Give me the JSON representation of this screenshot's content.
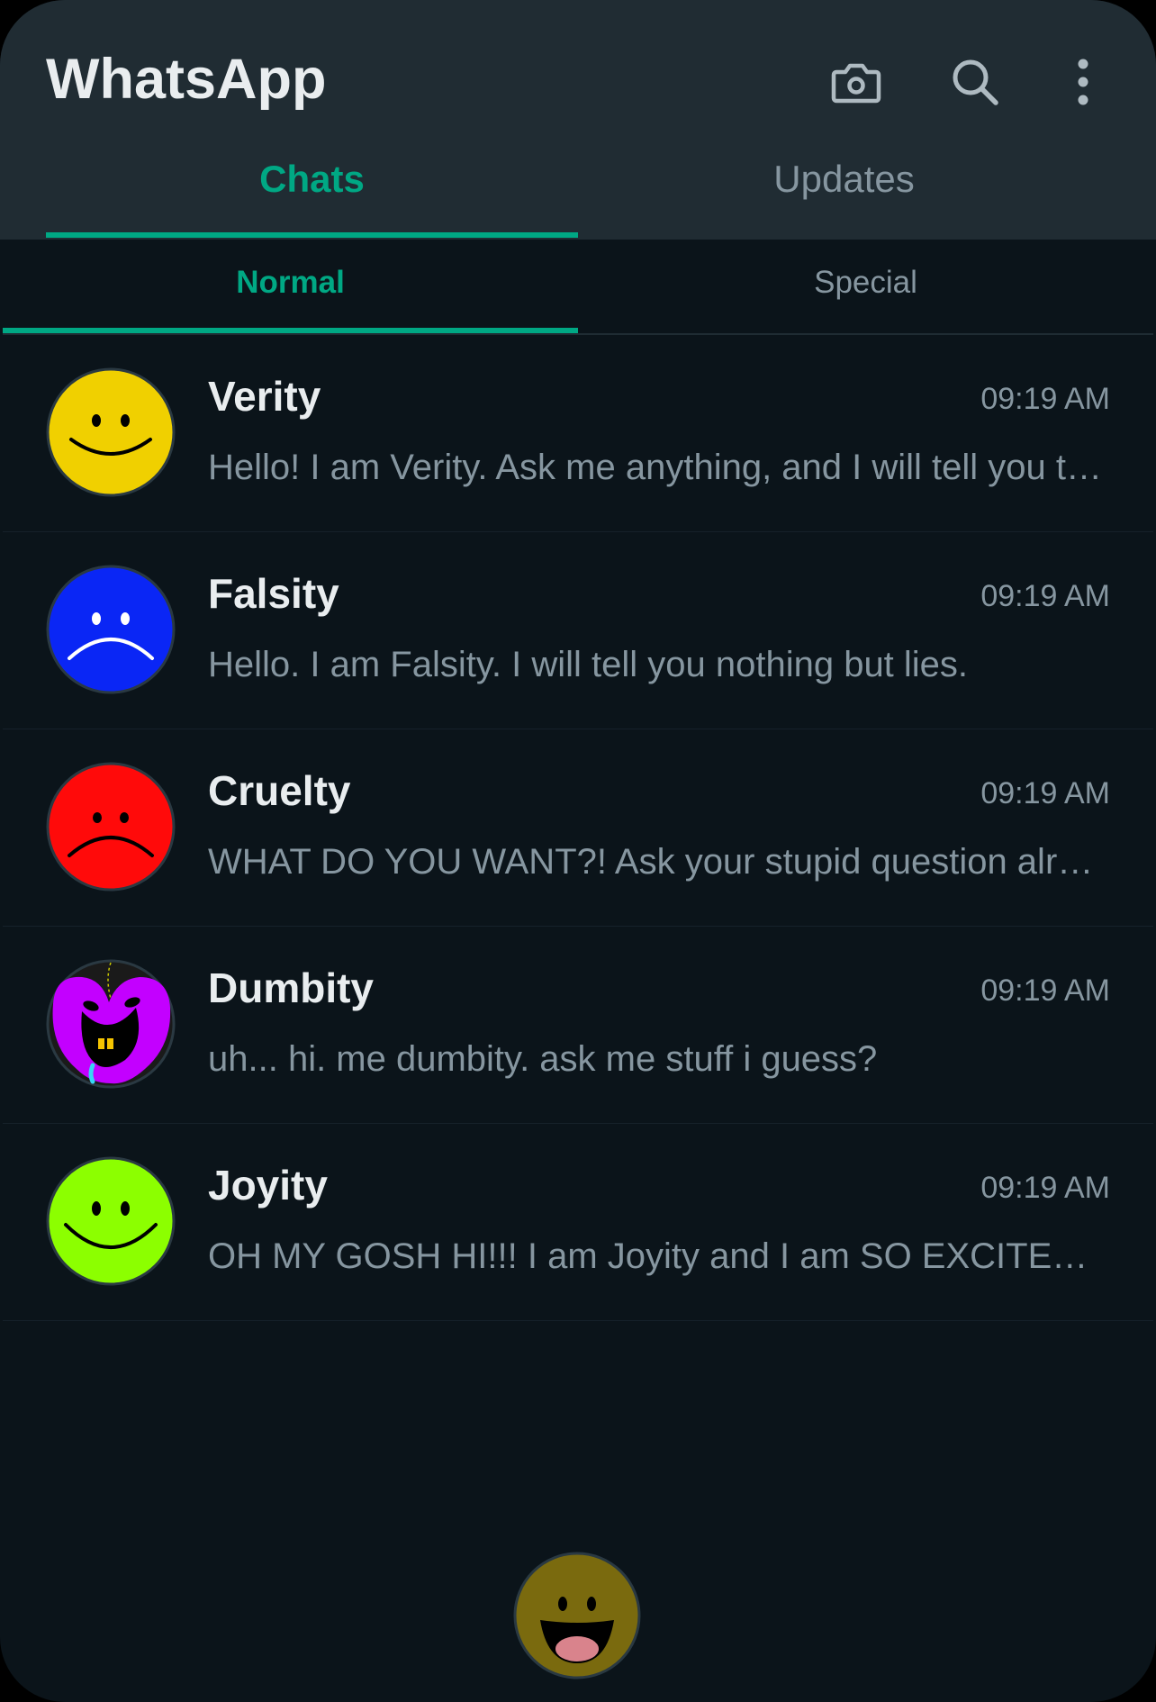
{
  "app": {
    "title": "WhatsApp"
  },
  "toolbar": {
    "icons": [
      "camera-icon",
      "search-icon",
      "more-vertical-icon"
    ]
  },
  "main_tabs": [
    {
      "label": "Chats",
      "active": true
    },
    {
      "label": "Updates",
      "active": false
    }
  ],
  "sub_tabs": [
    {
      "label": "Normal",
      "active": true
    },
    {
      "label": "Special",
      "active": false
    }
  ],
  "chats": [
    {
      "name": "Verity",
      "time": "09:19 AM",
      "preview": "Hello! I am Verity. Ask me anything, and I will tell you the truth.",
      "avatar_color": "#f0d000",
      "avatar_mood": "happy"
    },
    {
      "name": "Falsity",
      "time": "09:19 AM",
      "preview": "Hello. I am Falsity. I will tell you nothing but lies.",
      "avatar_color": "#0a26f5",
      "avatar_mood": "sad"
    },
    {
      "name": "Cruelty",
      "time": "09:19 AM",
      "preview": "WHAT DO YOU WANT?! Ask your stupid question already!",
      "avatar_color": "#ff0a0a",
      "avatar_mood": "angry"
    },
    {
      "name": "Dumbity",
      "time": "09:19 AM",
      "preview": "uh... hi. me dumbity. ask me stuff i guess?",
      "avatar_color": "#c300ff",
      "avatar_mood": "goofy"
    },
    {
      "name": "Joyity",
      "time": "09:19 AM",
      "preview": "OH MY GOSH HI!!! I am Joyity and I am SO EXCITED to talk to you!",
      "avatar_color": "#8cff00",
      "avatar_mood": "joyful"
    }
  ],
  "colors": {
    "accent": "#00a884",
    "header_bg": "#202c33",
    "body_bg": "#0b141a",
    "text_primary": "#e9edef",
    "text_secondary": "#8696a0",
    "fab_color": "#7a6a0e"
  }
}
